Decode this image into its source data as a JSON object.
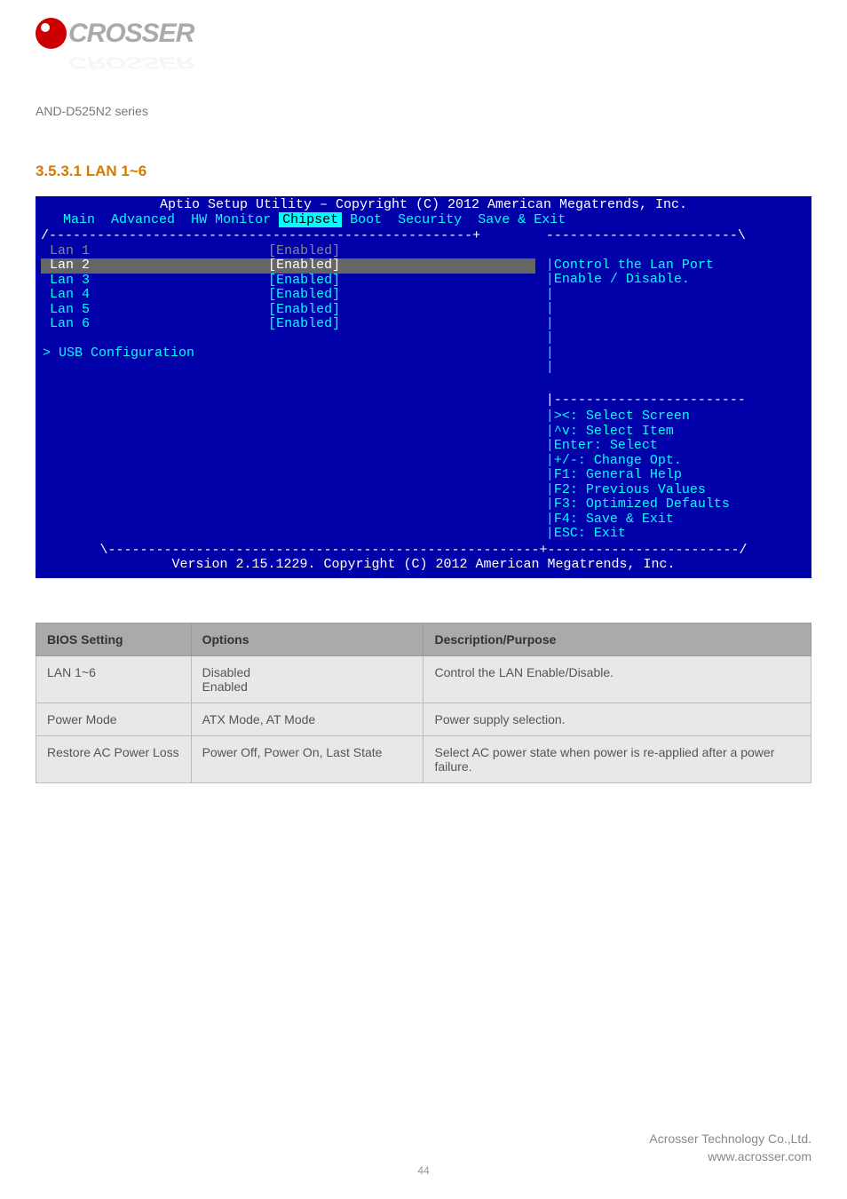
{
  "logo": {
    "text": "CROSSER",
    "reflection": "CROSSER"
  },
  "model_line": "AND-D525N2 series",
  "section_title": "3.5.3.1 LAN 1~6",
  "bios": {
    "title": "Aptio Setup Utility – Copyright (C) 2012 American Megatrends, Inc.",
    "tabs": [
      "Main",
      "Advanced",
      "HW Monitor",
      "Chipset",
      "Boot",
      "Security",
      "Save & Exit"
    ],
    "active_tab": "Chipset",
    "items": [
      {
        "label": "Lan 1",
        "value": "[Enabled]",
        "selected": true
      },
      {
        "label": "Lan 2",
        "value": "[Enabled]",
        "highlight": true
      },
      {
        "label": "Lan 3",
        "value": "[Enabled]"
      },
      {
        "label": "Lan 4",
        "value": "[Enabled]"
      },
      {
        "label": "Lan 5",
        "value": "[Enabled]"
      },
      {
        "label": "Lan 6",
        "value": "[Enabled]"
      }
    ],
    "submenu": "USB Configuration",
    "help_desc1": "Control the Lan Port",
    "help_desc2": "Enable / Disable.",
    "keys": [
      "><: Select Screen",
      "^v: Select Item",
      "Enter: Select",
      "+/-: Change Opt.",
      "F1: General Help",
      "F2: Previous Values",
      "F3: Optimized Defaults",
      "F4: Save & Exit",
      "ESC: Exit"
    ],
    "version": "Version 2.15.1229. Copyright (C) 2012 American Megatrends, Inc."
  },
  "table": {
    "headers": [
      "BIOS Setting",
      "Options",
      "Description/Purpose"
    ],
    "rows": [
      {
        "setting": "LAN 1~6",
        "options": "Disabled\nEnabled",
        "desc": "Control the LAN Enable/Disable."
      },
      {
        "setting": "Power Mode",
        "options": "ATX Mode, AT Mode",
        "desc": "Power supply selection."
      },
      {
        "setting": "Restore AC Power Loss",
        "options": "Power Off, Power On, Last State",
        "desc": "Select AC power state when power is re-applied after a power failure."
      }
    ]
  },
  "footer": {
    "company": "Acrosser Technology Co.,Ltd.",
    "url": "www.acrosser.com"
  },
  "page_number": "44"
}
